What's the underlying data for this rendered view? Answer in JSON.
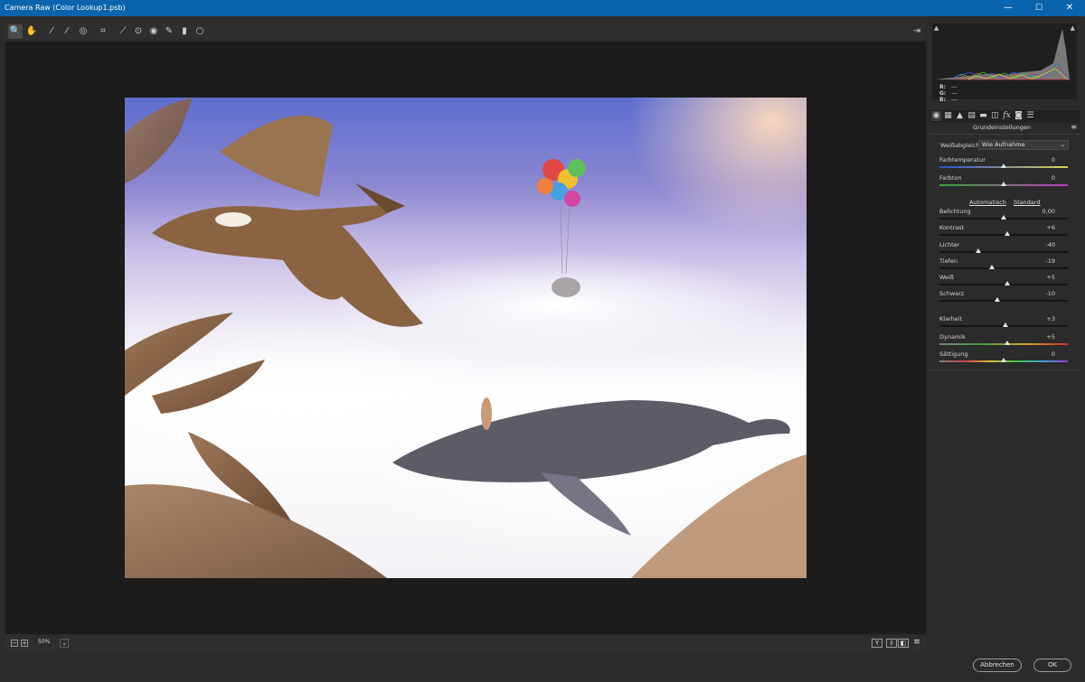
{
  "window": {
    "title": "Camera Raw (Color Lookup1.psb)",
    "controls": {
      "minimize": "—",
      "maximize": "☐",
      "close": "✕"
    }
  },
  "toolbar": {
    "tools": [
      {
        "name": "zoom-tool-icon",
        "glyph": "🔍"
      },
      {
        "name": "hand-tool-icon",
        "glyph": "✋"
      },
      {
        "name": "white-balance-tool-icon",
        "glyph": "⁄"
      },
      {
        "name": "color-sampler-tool-icon",
        "glyph": "⁄"
      },
      {
        "name": "targeted-adjustment-tool-icon",
        "glyph": "◎"
      },
      {
        "name": "crop-tool-icon",
        "glyph": "⌗"
      },
      {
        "name": "straighten-tool-icon",
        "glyph": "⟋"
      },
      {
        "name": "spot-removal-tool-icon",
        "glyph": "⊙"
      },
      {
        "name": "red-eye-tool-icon",
        "glyph": "◉"
      },
      {
        "name": "adjustment-brush-icon",
        "glyph": "✎"
      },
      {
        "name": "graduated-filter-icon",
        "glyph": "▮"
      },
      {
        "name": "radial-filter-icon",
        "glyph": "○"
      }
    ],
    "open_preferences_glyph": "⇥"
  },
  "statusbar": {
    "zoom_minus": "−",
    "zoom_plus": "+",
    "zoom_value": "50%",
    "zoom_dropdown": "⌄",
    "view_buttons": [
      "Y",
      "⇳",
      "◧",
      "≡"
    ]
  },
  "histogram": {
    "r_label": "R:",
    "r_value": "---",
    "g_label": "G:",
    "g_value": "---",
    "b_label": "B:",
    "b_value": "---"
  },
  "panel_tabs": [
    {
      "name": "basic-tab-icon",
      "glyph": "◉",
      "active": true
    },
    {
      "name": "tone-curve-tab-icon",
      "glyph": "▦"
    },
    {
      "name": "detail-tab-icon",
      "glyph": "▲"
    },
    {
      "name": "hsl-tab-icon",
      "glyph": "▤"
    },
    {
      "name": "split-toning-tab-icon",
      "glyph": "▬"
    },
    {
      "name": "lens-tab-icon",
      "glyph": "◫"
    },
    {
      "name": "effects-tab-icon",
      "glyph": "fx"
    },
    {
      "name": "camera-calibration-tab-icon",
      "glyph": "◙"
    },
    {
      "name": "presets-tab-icon",
      "glyph": "☰"
    }
  ],
  "panel": {
    "title": "Grundeinstellungen",
    "menu_glyph": "≡",
    "white_balance_label": "Weißabgleich:",
    "white_balance_value": "Wie Aufnahme",
    "auto_link": "Automatisch",
    "default_link": "Standard",
    "sliders": [
      {
        "id": "farbtemperatur",
        "label": "Farbtemperatur",
        "value": "0",
        "level": 0.5,
        "track": "linear-gradient(90deg,#2f4fd0,#d9d35a)"
      },
      {
        "id": "farbton",
        "label": "Farbton",
        "value": "0",
        "level": 0.5,
        "track": "linear-gradient(90deg,#3aa63a,#c040c0)"
      },
      {
        "id": "belichtung",
        "label": "Belichtung",
        "value": "0,00",
        "level": 0.5,
        "track": "#151515"
      },
      {
        "id": "kontrast",
        "label": "Kontrast",
        "value": "+6",
        "level": 0.53,
        "track": "#151515"
      },
      {
        "id": "lichter",
        "label": "Lichter",
        "value": "-40",
        "level": 0.3,
        "track": "#151515"
      },
      {
        "id": "tiefen",
        "label": "Tiefen",
        "value": "-19",
        "level": 0.405,
        "track": "#151515"
      },
      {
        "id": "weiss",
        "label": "Weiß",
        "value": "+5",
        "level": 0.525,
        "track": "#151515"
      },
      {
        "id": "schwarz",
        "label": "Schwarz",
        "value": "-10",
        "level": 0.45,
        "track": "#151515"
      },
      {
        "id": "klarheit",
        "label": "Klarheit",
        "value": "+3",
        "level": 0.515,
        "track": "#151515"
      },
      {
        "id": "dynamik",
        "label": "Dynamik",
        "value": "+5",
        "level": 0.525,
        "track": "linear-gradient(90deg,#7a7a7a,#3c9a3c,#d0a030,#c03030)"
      },
      {
        "id": "saettigung",
        "label": "Sättigung",
        "value": "0",
        "level": 0.5,
        "track": "linear-gradient(90deg,#7a7a7a,#d04040,#d0c040,#40c040,#40a0d0,#9040d0)"
      }
    ]
  },
  "footer": {
    "cancel_label": "Abbrechen",
    "ok_label": "OK"
  }
}
